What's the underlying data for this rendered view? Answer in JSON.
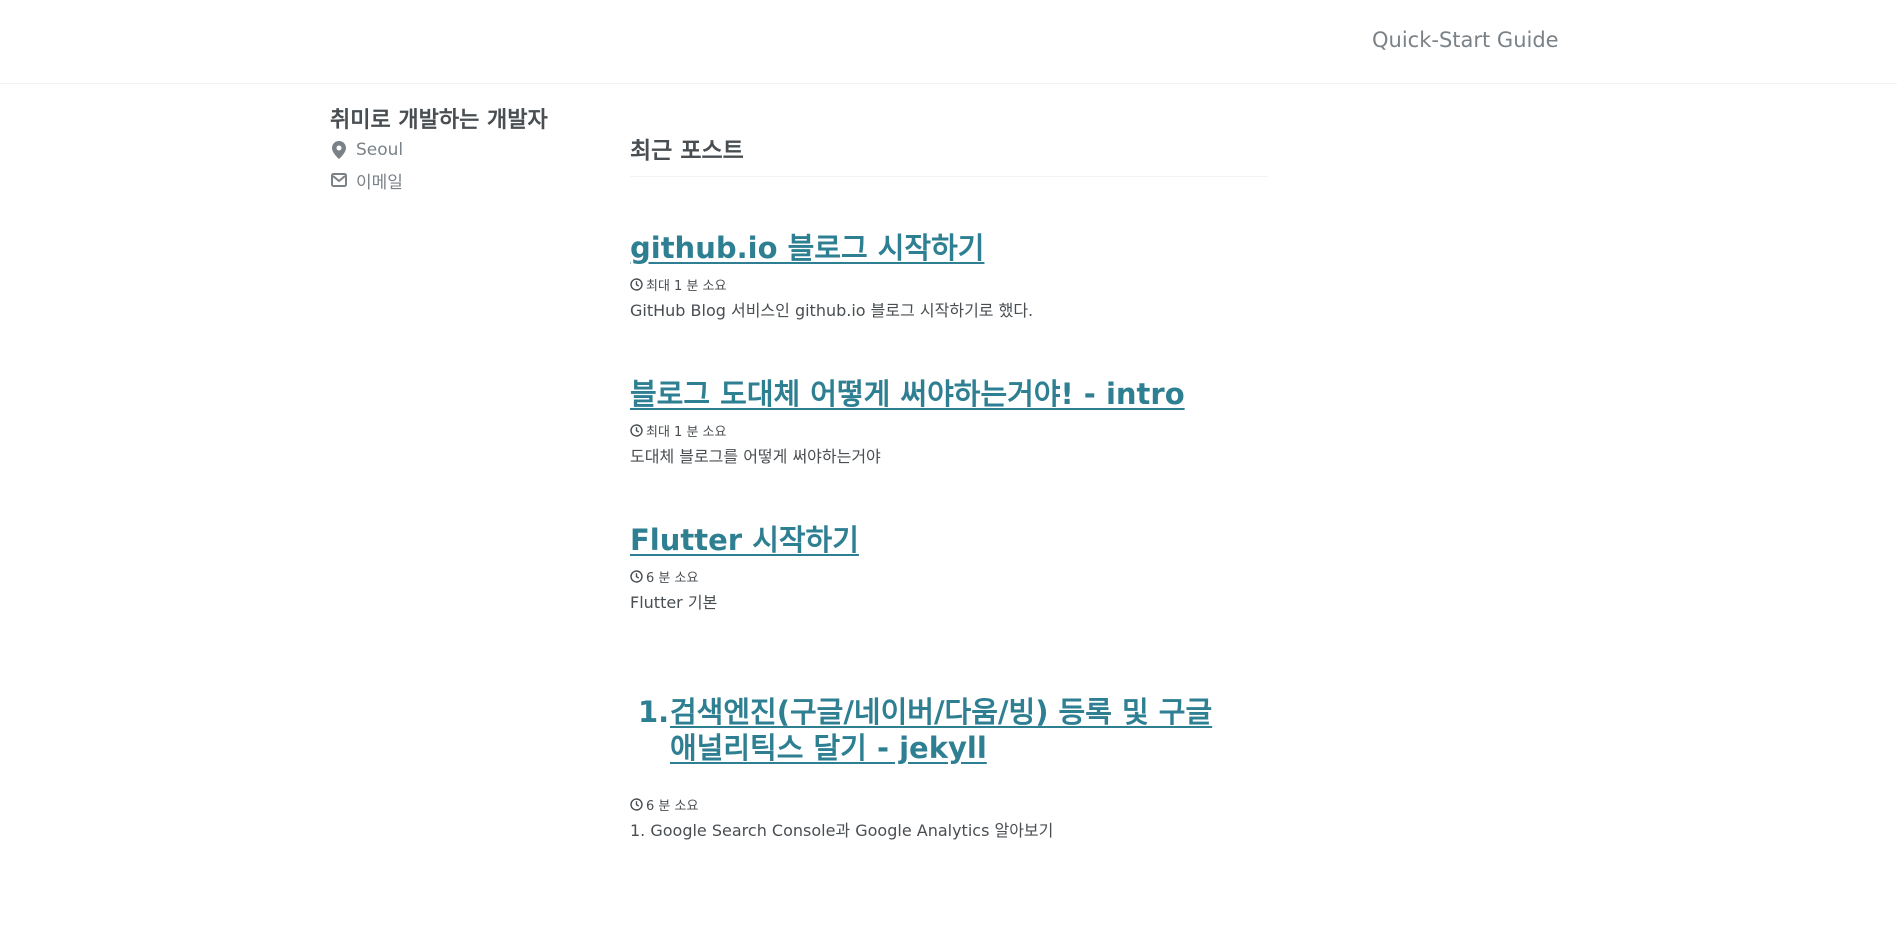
{
  "masthead": {
    "nav_link": "Quick-Start Guide"
  },
  "sidebar": {
    "author_name": "취미로 개발하는 개발자",
    "location": "Seoul",
    "location_icon": "map-marker-icon",
    "email_label": "이메일",
    "email_icon": "envelope-icon"
  },
  "main": {
    "heading": "최근 포스트",
    "posts": [
      {
        "title": "github.io 블로그 시작하기",
        "read_time": "최대 1 분 소요",
        "excerpt": "GitHub Blog 서비스인 github.io 블로그 시작하기로 했다."
      },
      {
        "title": "블로그 도대체 어떻게 써야하는거야! - intro",
        "read_time": "최대 1 분 소요",
        "excerpt": "도대체 블로그를 어떻게 써야하는거야"
      },
      {
        "title": "Flutter 시작하기",
        "read_time": "6 분 소요",
        "excerpt": "Flutter 기본"
      },
      {
        "number": "1.",
        "title": "검색엔진(구글/네이버/다움/빙) 등록 및 구글 애널리틱스 달기 - jekyll",
        "read_time": "6 분 소요",
        "excerpt": "1. Google Search Console과 Google Analytics 알아보기"
      }
    ]
  },
  "colors": {
    "link": "#2f7f93",
    "text": "#494e52",
    "muted": "#7a8288"
  }
}
